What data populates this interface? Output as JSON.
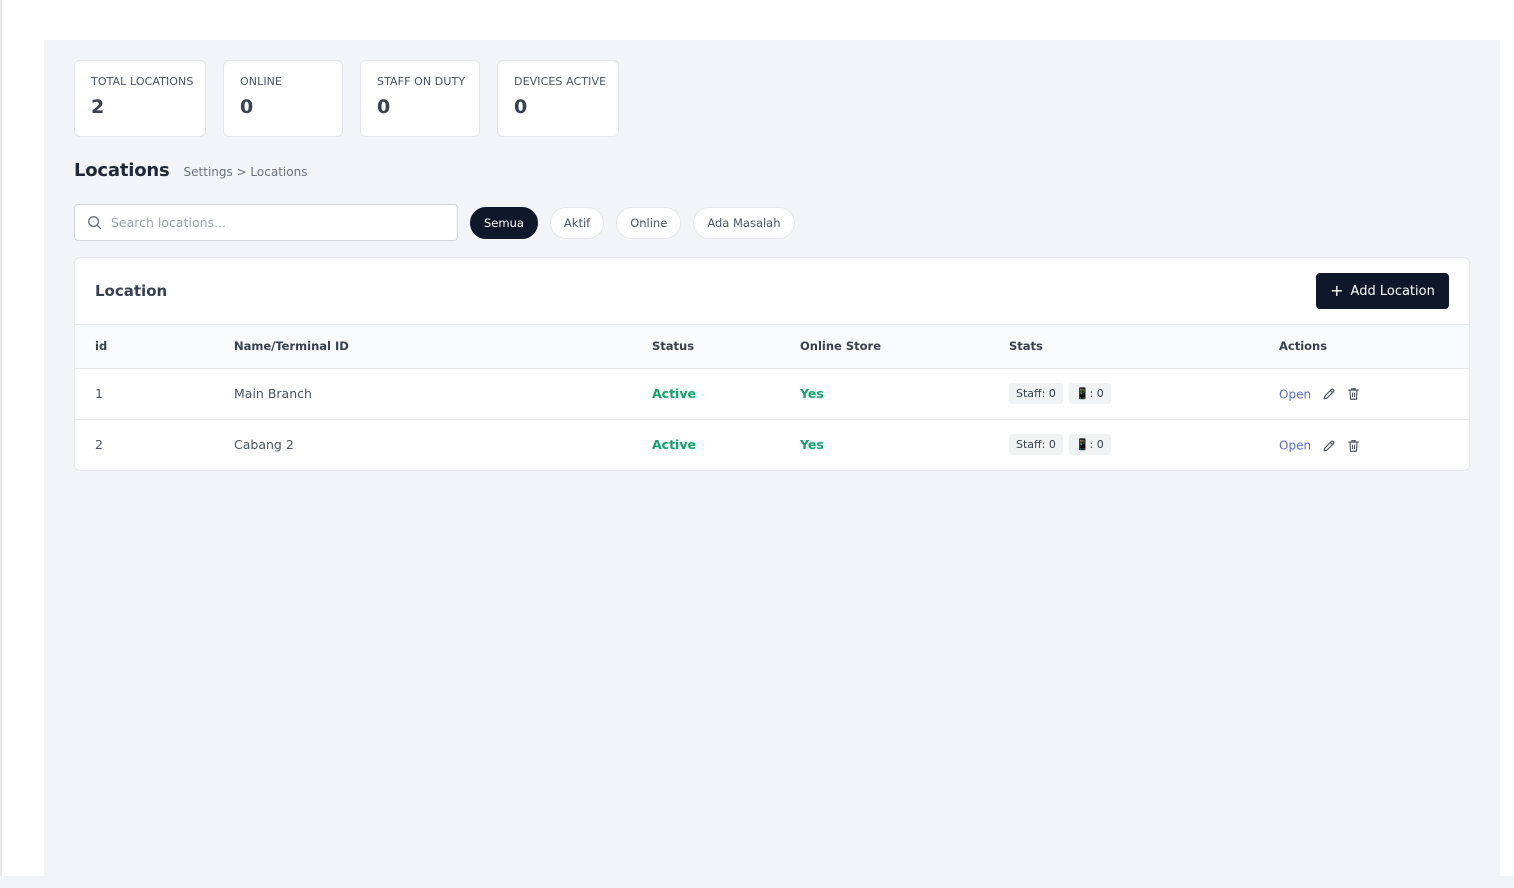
{
  "stats": [
    {
      "label": "TOTAL LOCATIONS",
      "value": "2"
    },
    {
      "label": "ONLINE",
      "value": "0"
    },
    {
      "label": "STAFF ON DUTY",
      "value": "0"
    },
    {
      "label": "DEVICES ACTIVE",
      "value": "0"
    }
  ],
  "page": {
    "title": "Locations",
    "breadcrumb": "Settings > Locations"
  },
  "search": {
    "placeholder": "Search locations...",
    "icon": "search-icon"
  },
  "filters": [
    {
      "label": "Semua",
      "active": true
    },
    {
      "label": "Aktif",
      "active": false
    },
    {
      "label": "Online",
      "active": false
    },
    {
      "label": "Ada Masalah",
      "active": false
    }
  ],
  "panel": {
    "title": "Location",
    "add_button": "Add Location"
  },
  "table": {
    "headers": [
      "id",
      "Name/Terminal ID",
      "Status",
      "Online Store",
      "Stats",
      "Actions"
    ],
    "rows": [
      {
        "id": "1",
        "name": "Main Branch",
        "status": "Active",
        "online_store": "Yes",
        "staff": "Staff: 0",
        "devices": "📱: 0",
        "action": "Open"
      },
      {
        "id": "2",
        "name": "Cabang 2",
        "status": "Active",
        "online_store": "Yes",
        "staff": "Staff: 0",
        "devices": "📱: 0",
        "action": "Open"
      }
    ]
  },
  "colors": {
    "accent_dark": "#0f172a",
    "status_green": "#10a36a",
    "link_blue": "#5b6dcd"
  }
}
